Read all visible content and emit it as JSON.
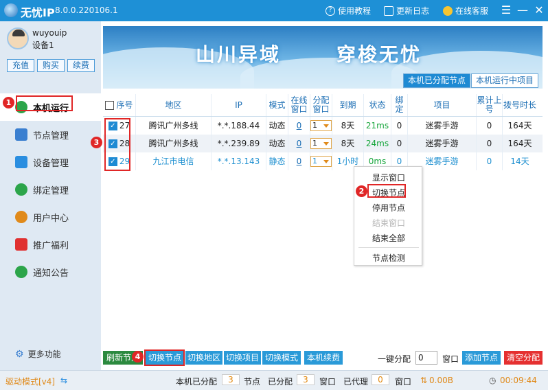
{
  "titlebar": {
    "app_name": "无忧IP",
    "version": "8.0.0.220106.1",
    "help_label": "使用教程",
    "changelog_label": "更新日志",
    "support_label": "在线客服",
    "menu_glyph": "☰",
    "minimize_glyph": "—",
    "close_glyph": "✕"
  },
  "user": {
    "name": "wuyouip",
    "device": "设备1"
  },
  "account_buttons": [
    "充值",
    "购买",
    "续费"
  ],
  "nav": [
    {
      "label": "本机运行",
      "icon": "play-icon",
      "color": "#2ca54a",
      "active": true
    },
    {
      "label": "节点管理",
      "icon": "node-tree-icon",
      "color": "#3a7fd0"
    },
    {
      "label": "设备管理",
      "icon": "device-icon",
      "color": "#2a8ee0"
    },
    {
      "label": "绑定管理",
      "icon": "bind-icon",
      "color": "#2ca54a"
    },
    {
      "label": "用户中心",
      "icon": "user-icon",
      "color": "#e08a1a"
    },
    {
      "label": "推广福利",
      "icon": "gift-icon",
      "color": "#e03030"
    },
    {
      "label": "通知公告",
      "icon": "bell-icon",
      "color": "#2ca54a"
    }
  ],
  "more_label": "更多功能",
  "banner": {
    "slogan1": "山川异域",
    "slogan2": "穿梭无忧"
  },
  "tabs": [
    "本机已分配节点",
    "本机运行中项目"
  ],
  "table": {
    "headers": [
      "序号",
      "地区",
      "IP",
      "模式",
      "在线窗口",
      "分配窗口",
      "到期",
      "状态",
      "绑定",
      "项目",
      "累计上号",
      "拨号时长"
    ],
    "rows": [
      {
        "id": "27",
        "region": "腾讯广州多线",
        "ip": "*.*.188.44",
        "mode": "动态",
        "online": "0",
        "alloc": "1",
        "expire": "8天",
        "status": "21ms",
        "bind": "0",
        "project": "迷雾手游",
        "total": "0",
        "duration": "164天"
      },
      {
        "id": "28",
        "region": "腾讯广州多线",
        "ip": "*.*.239.89",
        "mode": "动态",
        "online": "0",
        "alloc": "1",
        "expire": "8天",
        "status": "24ms",
        "bind": "0",
        "project": "迷雾手游",
        "total": "0",
        "duration": "164天"
      },
      {
        "id": "29",
        "region": "九江市电信",
        "ip": "*.*.13.143",
        "mode": "静态",
        "online": "0",
        "alloc": "1",
        "expire": "1小时",
        "status": "0ms",
        "bind": "0",
        "project": "迷雾手游",
        "total": "0",
        "duration": "14天"
      }
    ]
  },
  "context_menu": [
    "显示窗口",
    "切换节点",
    "停用节点",
    "结束窗口",
    "结束全部",
    "节点检测"
  ],
  "toolbar": {
    "refresh": "刷新节点",
    "switch_node": "切换节点",
    "switch_region": "切换地区",
    "switch_project": "切换项目",
    "switch_mode": "切换模式",
    "renew": "本机续费",
    "one_click_label": "一键分配",
    "one_click_value": "0",
    "window_label": "窗口",
    "add_node": "添加节点",
    "clear_alloc": "清空分配"
  },
  "annotations": [
    "1",
    "2",
    "3",
    "4"
  ],
  "statusbar": {
    "driver_mode": "驱动模式[v4]",
    "assigned_label": "本机已分配",
    "assigned_value": "3",
    "node_unit": "节点",
    "allocated_label": "已分配",
    "allocated_value": "3",
    "window_unit": "窗口",
    "proxied_label": "已代理",
    "proxied_value": "0",
    "window_unit2": "窗口",
    "traffic": "0.00B",
    "time": "00:09:44"
  }
}
